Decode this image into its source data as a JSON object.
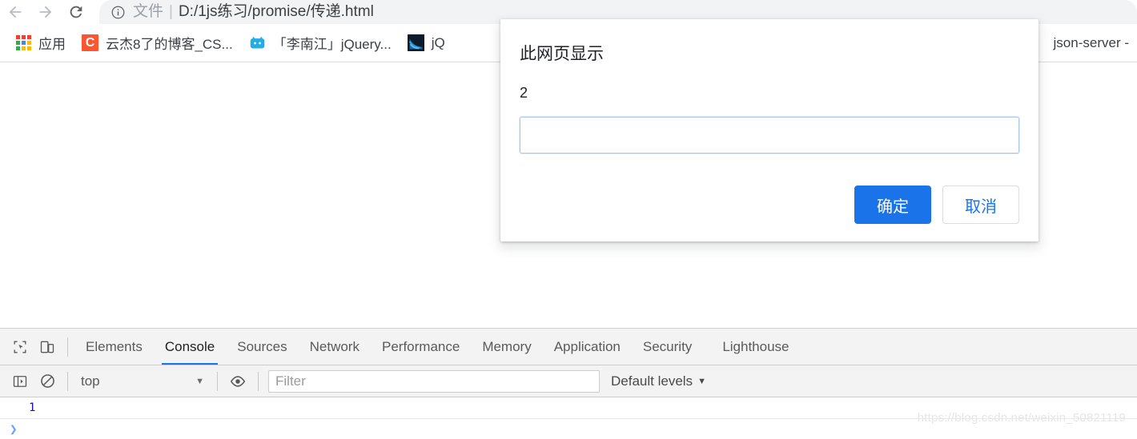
{
  "browser": {
    "nav": {
      "back_label": "Back",
      "forward_label": "Forward",
      "reload_label": "Reload"
    },
    "omnibox": {
      "security_chip": "文件",
      "separator": "|",
      "url": "D:/1js练习/promise/传递.html",
      "info_icon": "info-icon"
    },
    "bookmarks": [
      {
        "label": "应用",
        "icon": "apps-grid-icon"
      },
      {
        "label": "云杰8了的博客_CS...",
        "icon": "csdn-icon"
      },
      {
        "label": "「李南江」jQuery...",
        "icon": "bilibili-icon"
      },
      {
        "label": "jQ",
        "icon": "jquery-icon"
      }
    ],
    "bookmarks_overflow": "json-server -"
  },
  "dialog": {
    "title": "此网页显示",
    "message": "2",
    "input_value": "",
    "input_placeholder": "",
    "ok_label": "确定",
    "cancel_label": "取消",
    "accent_color": "#1a73e8",
    "border_color": "#a8c7f0"
  },
  "devtools": {
    "tabs": [
      {
        "label": "Elements",
        "active": false
      },
      {
        "label": "Console",
        "active": true
      },
      {
        "label": "Sources",
        "active": false
      },
      {
        "label": "Network",
        "active": false
      },
      {
        "label": "Performance",
        "active": false
      },
      {
        "label": "Memory",
        "active": false
      },
      {
        "label": "Application",
        "active": false
      },
      {
        "label": "Security",
        "active": false
      },
      {
        "label": "Lighthouse",
        "active": false
      }
    ],
    "console_toolbar": {
      "context": "top",
      "context_caret": "▼",
      "filter_placeholder": "Filter",
      "filter_value": "",
      "levels_label": "Default levels",
      "levels_caret": "▼",
      "clear_icon": "clear-console-icon",
      "sidebar_icon": "console-sidebar-icon",
      "eye_icon": "live-expression-icon",
      "inspect_icon": "inspect-element-icon",
      "device_icon": "device-toolbar-icon"
    },
    "console_messages": [
      {
        "text": "1",
        "type": "number"
      }
    ],
    "prompt_glyph": "❯"
  },
  "watermark": "https://blog.csdn.net/weixin_50821119"
}
